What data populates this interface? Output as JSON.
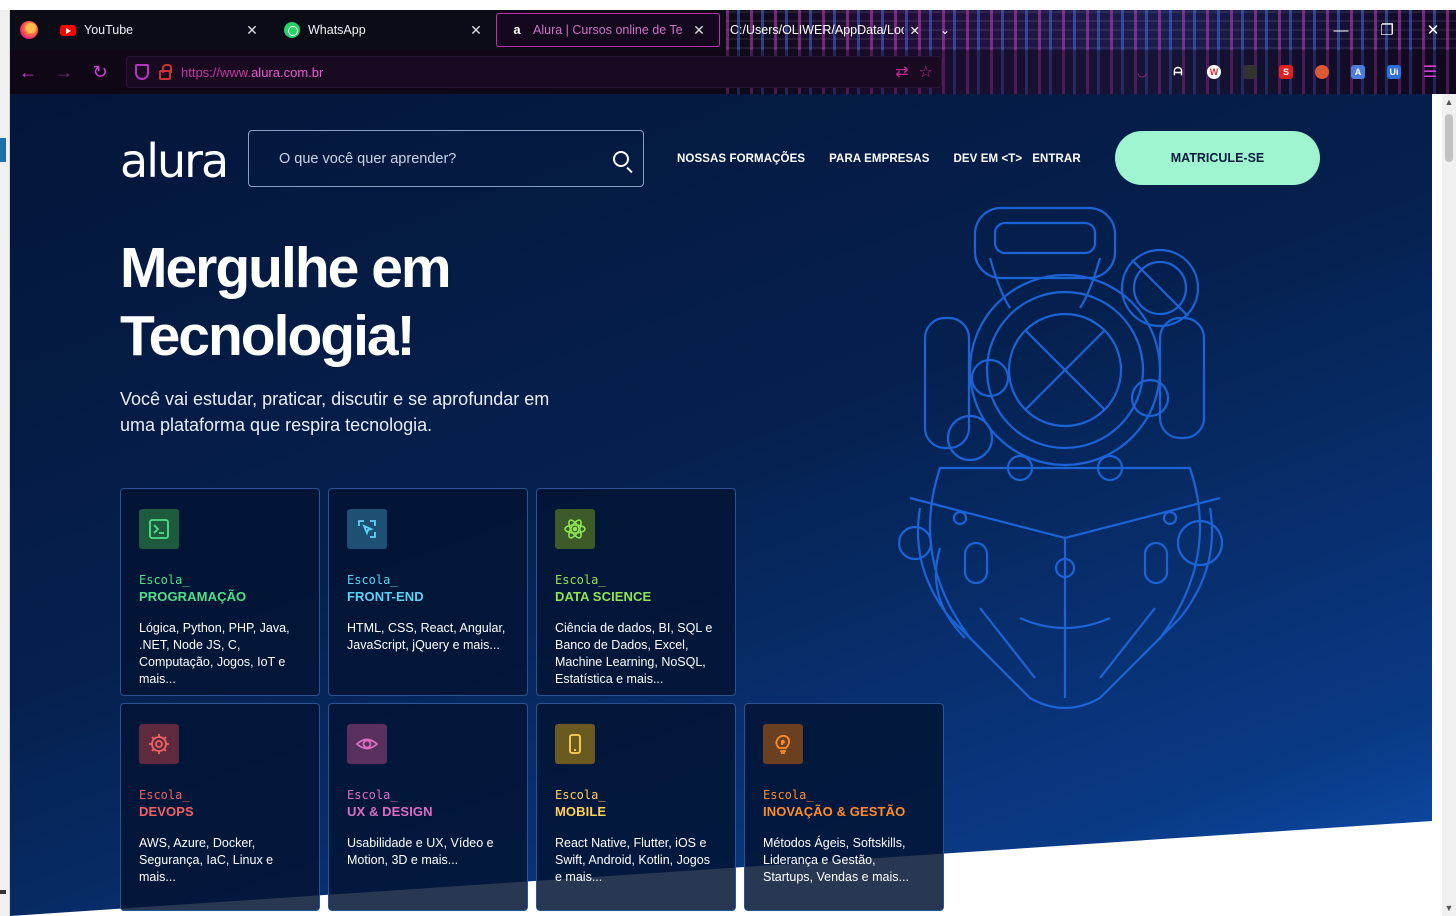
{
  "browser": {
    "tabs": [
      {
        "title": "YouTube",
        "active": false
      },
      {
        "title": "WhatsApp",
        "active": false
      },
      {
        "title": "Alura | Cursos online de Tecnol",
        "active": true
      },
      {
        "title": "C:/Users/OLIWER/AppData/Local",
        "active": false
      }
    ],
    "url_prefix": "https://www.",
    "url_host": "alura.com.br",
    "accent_color": "#d23fd6"
  },
  "header": {
    "logo": "alura",
    "search_placeholder": "O que você quer aprender?",
    "menu": [
      "NOSSAS FORMAÇÕES",
      "PARA EMPRESAS",
      "DEV EM <T>",
      "ENTRAR"
    ],
    "cta": "MATRICULE-SE"
  },
  "hero": {
    "title_line1": "Mergulhe em",
    "title_line2": "Tecnologia!",
    "subtitle": "Você vai estudar, praticar, discutir e se aprofundar em uma plataforma que respira tecnologia."
  },
  "schools": [
    {
      "prefix": "Escola_",
      "name": "PROGRAMAÇÃO",
      "color": "#4ee187",
      "icon": "terminal-icon",
      "desc": "Lógica, Python, PHP, Java, .NET, Node JS, C, Computação, Jogos, IoT e mais..."
    },
    {
      "prefix": "Escola_",
      "name": "FRONT-END",
      "color": "#5cd3f6",
      "icon": "cursor-frame-icon",
      "desc": "HTML, CSS, React, Angular, JavaScript, jQuery e mais..."
    },
    {
      "prefix": "Escola_",
      "name": "DATA SCIENCE",
      "color": "#8be651",
      "icon": "atom-icon",
      "desc": "Ciência de dados, BI, SQL e Banco de Dados, Excel, Machine Learning, NoSQL, Estatística e mais..."
    },
    {
      "prefix": "Escola_",
      "name": "DEVOPS",
      "color": "#f16165",
      "icon": "gear-icon",
      "desc": "AWS, Azure, Docker, Segurança, IaC, Linux e mais..."
    },
    {
      "prefix": "Escola_",
      "name": "UX & DESIGN",
      "color": "#dc6ec2",
      "icon": "eye-icon",
      "desc": "Usabilidade e UX, Vídeo e Motion, 3D e mais..."
    },
    {
      "prefix": "Escola_",
      "name": "MOBILE",
      "color": "#fed255",
      "icon": "smartphone-icon",
      "desc": "React Native, Flutter, iOS e Swift, Android, Kotlin, Jogos e mais..."
    },
    {
      "prefix": "Escola_",
      "name": "INOVAÇÃO & GESTÃO",
      "color": "#ff8c2a",
      "icon": "lightbulb-icon",
      "desc": "Métodos Ágeis, Softskills, Liderança e Gestão, Startups, Vendas e mais..."
    }
  ]
}
